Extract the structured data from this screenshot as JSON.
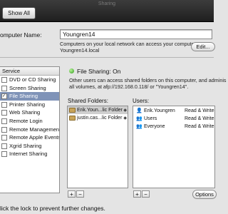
{
  "window": {
    "title": "Sharing",
    "show_all_label": "Show All"
  },
  "computer_name": {
    "label": "omputer Name:",
    "value": "Youngren14",
    "description_line1": "Computers on your local network can access your computer at:",
    "description_line2": "Youngren14.local",
    "edit_label": "Edit..."
  },
  "services": {
    "header": "Service",
    "items": [
      {
        "label": "DVD or CD Sharing",
        "checked": false,
        "selected": false
      },
      {
        "label": "Screen Sharing",
        "checked": false,
        "selected": false
      },
      {
        "label": "File Sharing",
        "checked": true,
        "selected": true
      },
      {
        "label": "Printer Sharing",
        "checked": false,
        "selected": false
      },
      {
        "label": "Web Sharing",
        "checked": false,
        "selected": false
      },
      {
        "label": "Remote Login",
        "checked": false,
        "selected": false
      },
      {
        "label": "Remote Management",
        "checked": false,
        "selected": false
      },
      {
        "label": "Remote Apple Events",
        "checked": false,
        "selected": false
      },
      {
        "label": "Xgrid Sharing",
        "checked": false,
        "selected": false
      },
      {
        "label": "Internet Sharing",
        "checked": false,
        "selected": false
      }
    ]
  },
  "status": {
    "text": "File Sharing: On",
    "color": "#2f9a1a",
    "description_line1": "Other users can access shared folders on this computer, and adminis",
    "description_line2": "all volumes, at afp://192.168.0.118/ or \"Youngren14\"."
  },
  "shared_folders": {
    "label": "Shared Folders:",
    "items": [
      {
        "label": "Erik.Youn...lic Folder",
        "selected": true
      },
      {
        "label": "justin.cas...lic Folder",
        "selected": false
      }
    ],
    "add_label": "+",
    "remove_label": "−"
  },
  "users": {
    "label": "Users:",
    "items": [
      {
        "name": "Erik.Youngren",
        "permission": "Read & Write",
        "icon": "person-icon"
      },
      {
        "name": "Users",
        "permission": "Read & Write",
        "icon": "group-icon"
      },
      {
        "name": "Everyone",
        "permission": "Read & Write",
        "icon": "group-icon"
      }
    ],
    "add_label": "+",
    "remove_label": "−",
    "options_label": "Options"
  },
  "footer": {
    "text": "lick the lock to prevent further changes."
  }
}
